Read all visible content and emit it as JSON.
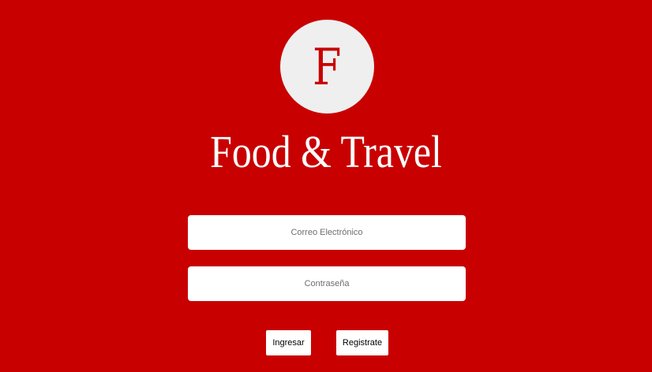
{
  "brand": {
    "logo_letter": "F",
    "title": "Food & Travel"
  },
  "form": {
    "email_placeholder": "Correo Electrónico",
    "password_placeholder": "Contraseña",
    "email_value": "",
    "password_value": ""
  },
  "buttons": {
    "login_label": "Ingresar",
    "register_label": "Registrate"
  },
  "colors": {
    "background": "#c80000",
    "logo_circle": "#efefef",
    "text_light": "#ffffff"
  }
}
